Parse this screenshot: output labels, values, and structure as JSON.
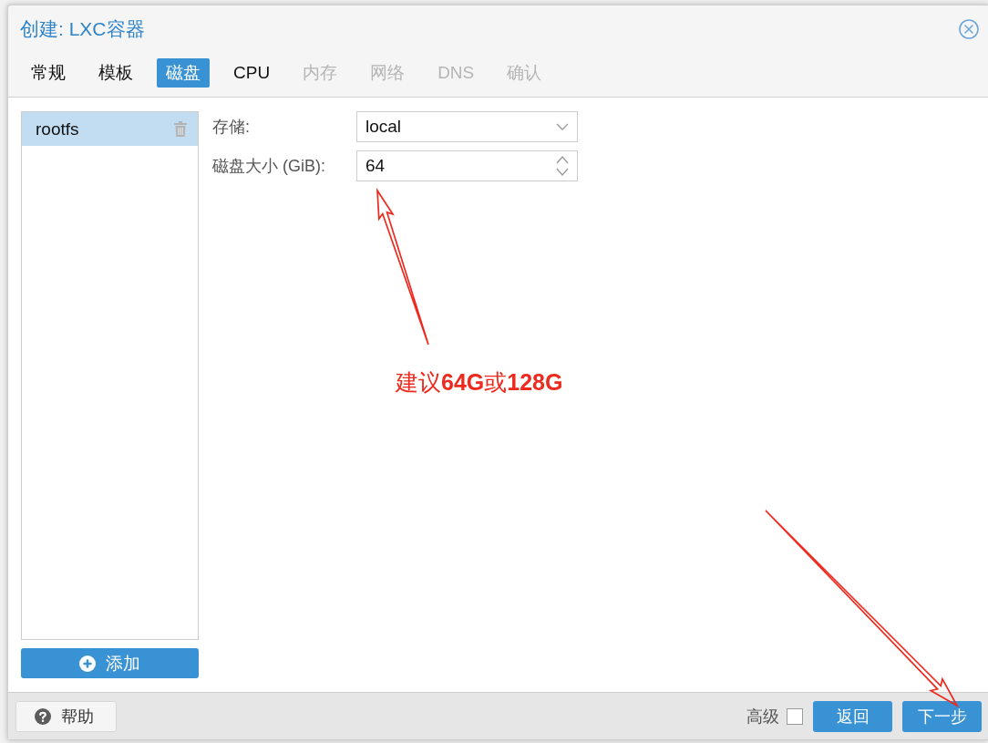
{
  "dialog": {
    "title": "创建: LXC容器"
  },
  "tabs": [
    {
      "label": "常规",
      "selected": false,
      "disabled": false
    },
    {
      "label": "模板",
      "selected": false,
      "disabled": false
    },
    {
      "label": "磁盘",
      "selected": true,
      "disabled": false
    },
    {
      "label": "CPU",
      "selected": false,
      "disabled": false
    },
    {
      "label": "内存",
      "selected": false,
      "disabled": true
    },
    {
      "label": "网络",
      "selected": false,
      "disabled": true
    },
    {
      "label": "DNS",
      "selected": false,
      "disabled": true
    },
    {
      "label": "确认",
      "selected": false,
      "disabled": true
    }
  ],
  "disk_list": {
    "items": [
      {
        "label": "rootfs",
        "selected": true
      }
    ],
    "add_button": "添加"
  },
  "form": [
    {
      "kind": "select",
      "label": "存储:",
      "value": "local"
    },
    {
      "kind": "number",
      "label": "磁盘大小 (GiB):",
      "value": "64"
    }
  ],
  "annotation": {
    "text": "建议**64G**或**128G**"
  },
  "footer": {
    "help_button": "帮助",
    "advanced": {
      "label": "高级",
      "checked": false
    },
    "buttons": [
      "返回",
      "下一步"
    ]
  }
}
